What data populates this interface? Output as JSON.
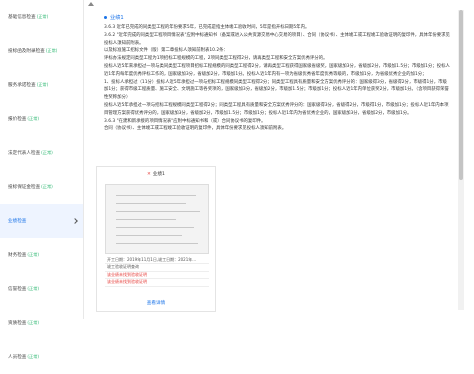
{
  "sidebar": {
    "items": [
      {
        "label": "基础信息检查",
        "tag": "(正常)"
      },
      {
        "label": "投标函及附录检查",
        "tag": "(正常)"
      },
      {
        "label": "服务承诺检查",
        "tag": "(正常)"
      },
      {
        "label": "报价检查",
        "tag": "(正常)"
      },
      {
        "label": "法定代表人检查",
        "tag": "(正常)"
      },
      {
        "label": "投标保证金检查",
        "tag": "(正常)"
      },
      {
        "label": "业绩检查",
        "tag": "",
        "active": true
      },
      {
        "label": "财务检查",
        "tag": "(正常)"
      },
      {
        "label": "信誉检查",
        "tag": "(正常)"
      },
      {
        "label": "资质检查",
        "tag": "(正常)"
      },
      {
        "label": "人员检查",
        "tag": "(正常)"
      }
    ]
  },
  "main": {
    "section_title": "业绩1",
    "paragraphs": [
      "3.6.3 近年已完成的同类型工程的年份要求5年，已完成是指主体竣工验收时间，5年是指开标日期5年内。",
      "3.6.2 \"近年完成的同类型工程项目情况表\"应附中标通知书（备案或进入公共资源交易中心交易的项目）、合同（协议书）、主体竣工或工程竣工验收证明的复印件，具体年份要求见投标人须知前附表。",
      "以及标准施工招标文件（版）第二章投标人须知前附表10.2条：",
      "评标办法规定同类型工程为1项招标工程规模的工程，2项同类型工程得2分，请再类型工程和安全方案优秀评分的。",
      "投标人近5年来承担过一项与类同类型工程项目招标工程规模的同类型工程得2分，请再类型工程获得国家级省级奖，国家级加3分，省级加2分，市级加1.5分；市级加1分；投标人近1年内每年度优秀评标工作的，国家级加3分，省级加2分，市级加1分。投标人近1年内有一项为省级优秀省年度优秀等级的，市级加1分，为省级优秀企业的加1分；",
      "1、投标人承担过（11分）投标人近5年承担过一项与招标工程规模同类型工程得2分；同类型工程具有质量和安全方案优秀评分的：国家级得3分，省级得2分，市级得1分，市级加1分；获得市级工程质量、施工安全、文明施工等各奖项的，国家级加3分，省级加2分，市级加1.5分；市级加1分；投标人近1年内单位获奖2分，市级加1分。（含项目获得荣誉性奖称加分）",
      "投标人近5年承担过一项与招标工程规模同类型工程得2分；同类型工程具有质量和安全方案优秀评分的：国家级得3分，省级得2分，市级得1分，市级加1分；投标人近1年内本项目管理方案获得优秀评分的，国家级加3分，省级加2分，市级加1.5分；市级加1分；投标人近1年内为省优秀企业的，国家级加3分，省级加2分，市级加1分。",
      "3.6.3 \"在建和新承接的项目情况表\"应附中标通知书和（或）合同协议书的复印件。",
      "合同（协议书）、主体竣工或工程竣工验收证明的复印件，具体年份要求见投标人须知前附表。"
    ]
  },
  "card": {
    "title": "业绩1",
    "info_rows": [
      "开工日期：2019年11月1日,竣工日期：2021年...",
      "竣工验收证明查询",
      "该业绩未找到验收证明",
      "该业绩未找到验收证明"
    ],
    "link": "查看详情"
  }
}
